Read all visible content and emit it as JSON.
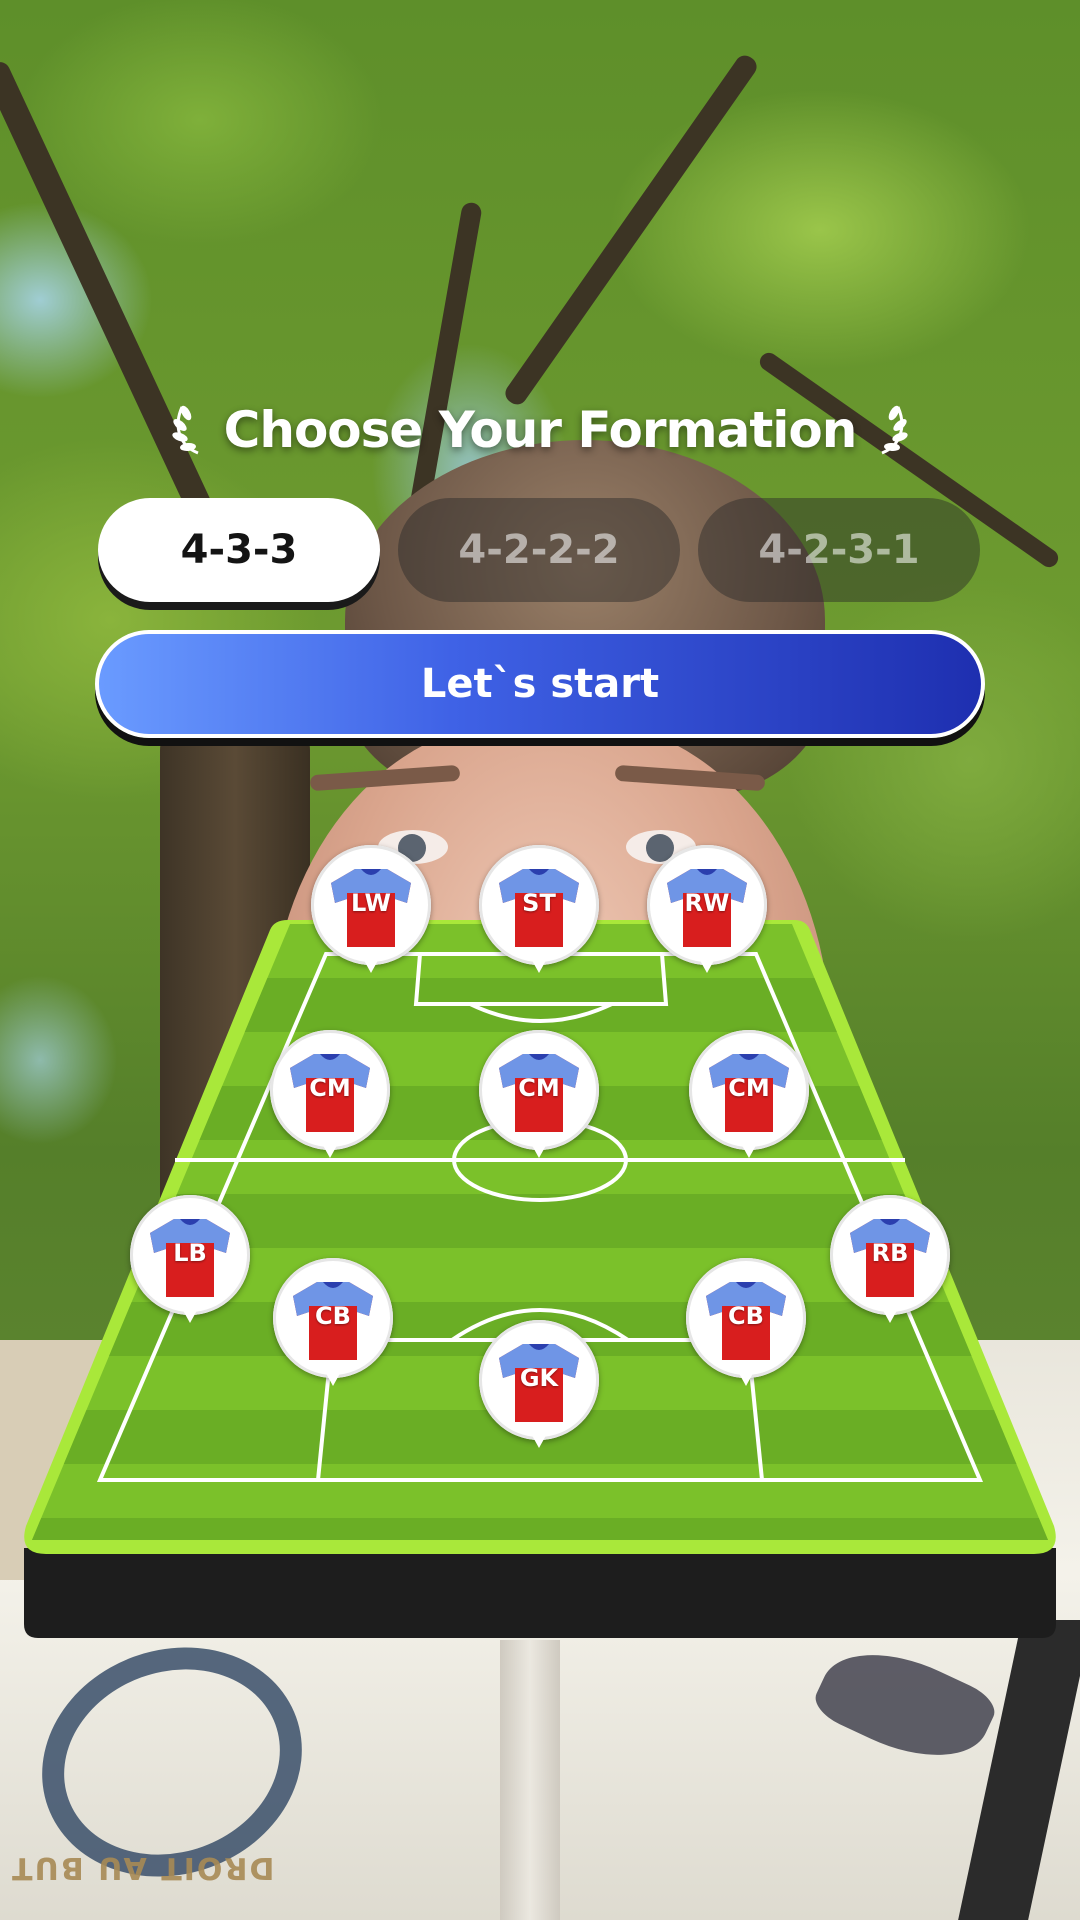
{
  "header": {
    "title": "Choose Your Formation"
  },
  "formations": {
    "options": [
      "4-3-3",
      "4-2-2-2",
      "4-2-3-1"
    ],
    "selected": "4-3-3"
  },
  "actions": {
    "start_label": "Let`s start"
  },
  "players": [
    {
      "pos": "LW"
    },
    {
      "pos": "ST"
    },
    {
      "pos": "RW"
    },
    {
      "pos": "CM"
    },
    {
      "pos": "CM"
    },
    {
      "pos": "CM"
    },
    {
      "pos": "LB"
    },
    {
      "pos": "CB"
    },
    {
      "pos": "CB"
    },
    {
      "pos": "RB"
    },
    {
      "pos": "GK"
    }
  ],
  "colors": {
    "accent_blue_start": "#6a9bff",
    "accent_blue_end": "#1e2fb0",
    "pitch_green": "#7bc12a",
    "jersey_red": "#d81e1e",
    "jersey_sleeve": "#6f95e6"
  }
}
